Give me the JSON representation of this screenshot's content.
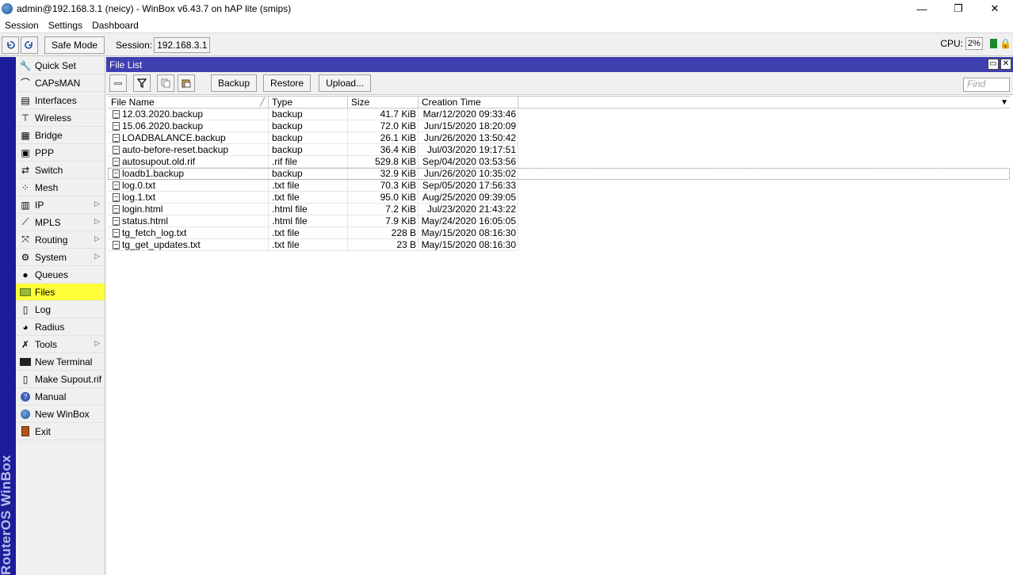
{
  "window": {
    "title": "admin@192.168.3.1 (neicy) - WinBox v6.43.7 on hAP lite (smips)",
    "controls": [
      "—",
      "❐",
      "✕"
    ]
  },
  "menubar": [
    "Session",
    "Settings",
    "Dashboard"
  ],
  "toolbar": {
    "undo_icon": "undo-icon",
    "redo_icon": "redo-icon",
    "safe_mode": "Safe Mode",
    "session_label": "Session:",
    "session_value": "192.168.3.1",
    "cpu_label": "CPU:",
    "cpu_value": "2%"
  },
  "side_strip_text": "RouterOS WinBox",
  "sidebar": {
    "items": [
      {
        "label": "Quick Set",
        "icon": "quickset-icon",
        "submenu": false
      },
      {
        "label": "CAPsMAN",
        "icon": "capsman-icon",
        "submenu": false
      },
      {
        "label": "Interfaces",
        "icon": "interfaces-icon",
        "submenu": false
      },
      {
        "label": "Wireless",
        "icon": "wireless-icon",
        "submenu": false
      },
      {
        "label": "Bridge",
        "icon": "bridge-icon",
        "submenu": false
      },
      {
        "label": "PPP",
        "icon": "ppp-icon",
        "submenu": false
      },
      {
        "label": "Switch",
        "icon": "switch-icon",
        "submenu": false
      },
      {
        "label": "Mesh",
        "icon": "mesh-icon",
        "submenu": false
      },
      {
        "label": "IP",
        "icon": "ip-icon",
        "submenu": true
      },
      {
        "label": "MPLS",
        "icon": "mpls-icon",
        "submenu": true
      },
      {
        "label": "Routing",
        "icon": "routing-icon",
        "submenu": true
      },
      {
        "label": "System",
        "icon": "system-icon",
        "submenu": true
      },
      {
        "label": "Queues",
        "icon": "queues-icon",
        "submenu": false
      },
      {
        "label": "Files",
        "icon": "files-icon",
        "submenu": false
      },
      {
        "label": "Log",
        "icon": "log-icon",
        "submenu": false
      },
      {
        "label": "Radius",
        "icon": "radius-icon",
        "submenu": false
      },
      {
        "label": "Tools",
        "icon": "tools-icon",
        "submenu": true
      },
      {
        "label": "New Terminal",
        "icon": "terminal-icon",
        "submenu": false
      },
      {
        "label": "Make Supout.rif",
        "icon": "supout-icon",
        "submenu": false
      },
      {
        "label": "Manual",
        "icon": "manual-icon",
        "submenu": false
      },
      {
        "label": "New WinBox",
        "icon": "winbox-icon",
        "submenu": false
      },
      {
        "label": "Exit",
        "icon": "exit-icon",
        "submenu": false
      }
    ],
    "active": "Files",
    "highlight_color": "#ffff3a"
  },
  "file_list": {
    "title": "File List",
    "buttons": {
      "backup": "Backup",
      "restore": "Restore",
      "upload": "Upload..."
    },
    "find_placeholder": "Find",
    "columns": [
      "File Name",
      "Type",
      "Size",
      "Creation Time"
    ],
    "rows": [
      {
        "name": "12.03.2020.backup",
        "type": "backup",
        "size": "41.7 KiB",
        "time": "Mar/12/2020 09:33:46"
      },
      {
        "name": "15.06.2020.backup",
        "type": "backup",
        "size": "72.0 KiB",
        "time": "Jun/15/2020 18:20:09"
      },
      {
        "name": "LOADBALANCE.backup",
        "type": "backup",
        "size": "26.1 KiB",
        "time": "Jun/26/2020 13:50:42"
      },
      {
        "name": "auto-before-reset.backup",
        "type": "backup",
        "size": "36.4 KiB",
        "time": "Jul/03/2020 19:17:51"
      },
      {
        "name": "autosupout.old.rif",
        "type": ".rif file",
        "size": "529.8 KiB",
        "time": "Sep/04/2020 03:53:56"
      },
      {
        "name": "loadb1.backup",
        "type": "backup",
        "size": "32.9 KiB",
        "time": "Jun/26/2020 10:35:02"
      },
      {
        "name": "log.0.txt",
        "type": ".txt file",
        "size": "70.3 KiB",
        "time": "Sep/05/2020 17:56:33"
      },
      {
        "name": "log.1.txt",
        "type": ".txt file",
        "size": "95.0 KiB",
        "time": "Aug/25/2020 09:39:05"
      },
      {
        "name": "login.html",
        "type": ".html file",
        "size": "7.2 KiB",
        "time": "Jul/23/2020 21:43:22"
      },
      {
        "name": "status.html",
        "type": ".html file",
        "size": "7.9 KiB",
        "time": "May/24/2020 16:05:05"
      },
      {
        "name": "tg_fetch_log.txt",
        "type": ".txt file",
        "size": "228 B",
        "time": "May/15/2020 08:16:30"
      },
      {
        "name": "tg_get_updates.txt",
        "type": ".txt file",
        "size": "23 B",
        "time": "May/15/2020 08:16:30"
      }
    ],
    "selected_row": 5
  }
}
